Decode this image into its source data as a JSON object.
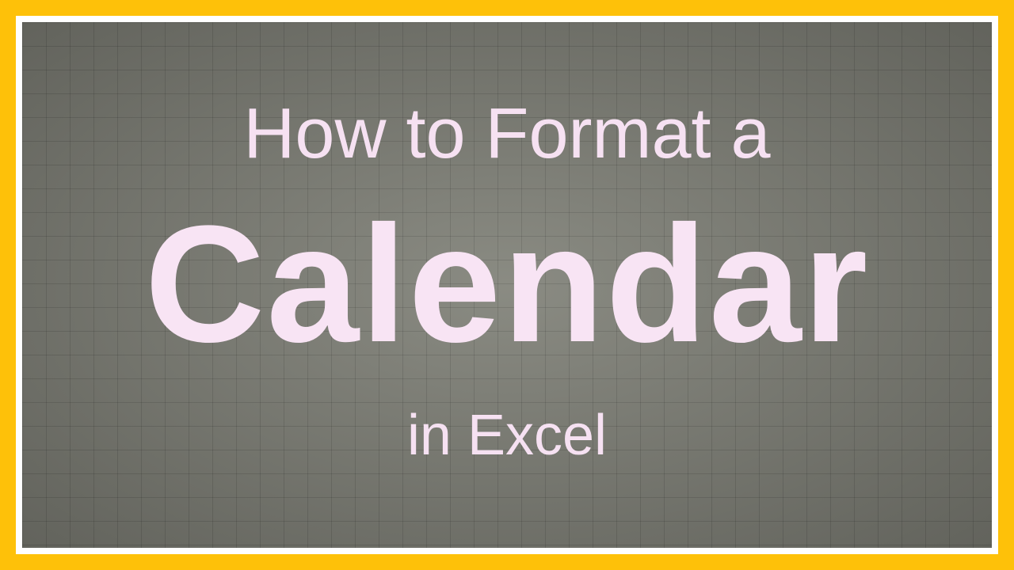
{
  "title": {
    "line1": "How to Format a",
    "line2": "Calendar",
    "line3": "in Excel"
  },
  "colors": {
    "frame": "#FEC109",
    "innerFrame": "#ffffff",
    "background": "#83847b",
    "text": "#F6E1F2"
  }
}
